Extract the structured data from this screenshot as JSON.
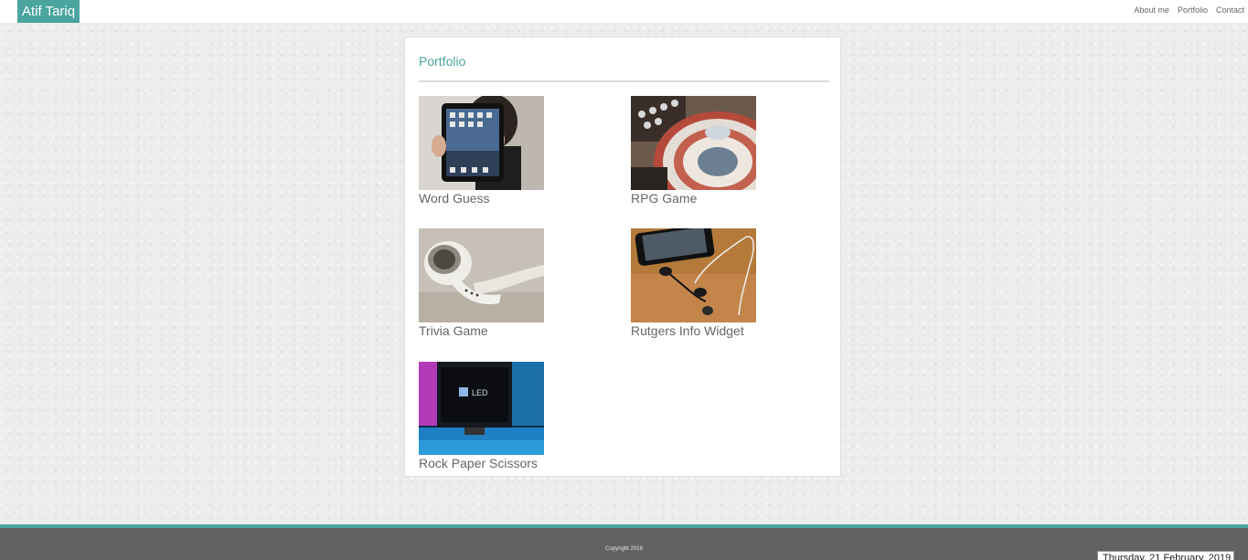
{
  "header": {
    "brand": "Atif Tariq",
    "nav": [
      {
        "label": "About me"
      },
      {
        "label": "Portfolio"
      },
      {
        "label": "Contact"
      }
    ]
  },
  "portfolio": {
    "title": "Portfolio",
    "projects": [
      {
        "label": "Word Guess",
        "icon": "tablet-image"
      },
      {
        "label": "RPG Game",
        "icon": "turntable-image"
      },
      {
        "label": "Trivia Game",
        "icon": "earbud-image"
      },
      {
        "label": "Rutgers Info Widget",
        "icon": "phone-earphones-image"
      },
      {
        "label": "Rock Paper Scissors",
        "icon": "led-tv-image"
      }
    ]
  },
  "footer": {
    "copyright": "Copyright 2019",
    "date": "Thursday, 21 February, 2019"
  },
  "colors": {
    "accent": "#4aa59f",
    "footer": "#626262",
    "text": "#666666"
  }
}
